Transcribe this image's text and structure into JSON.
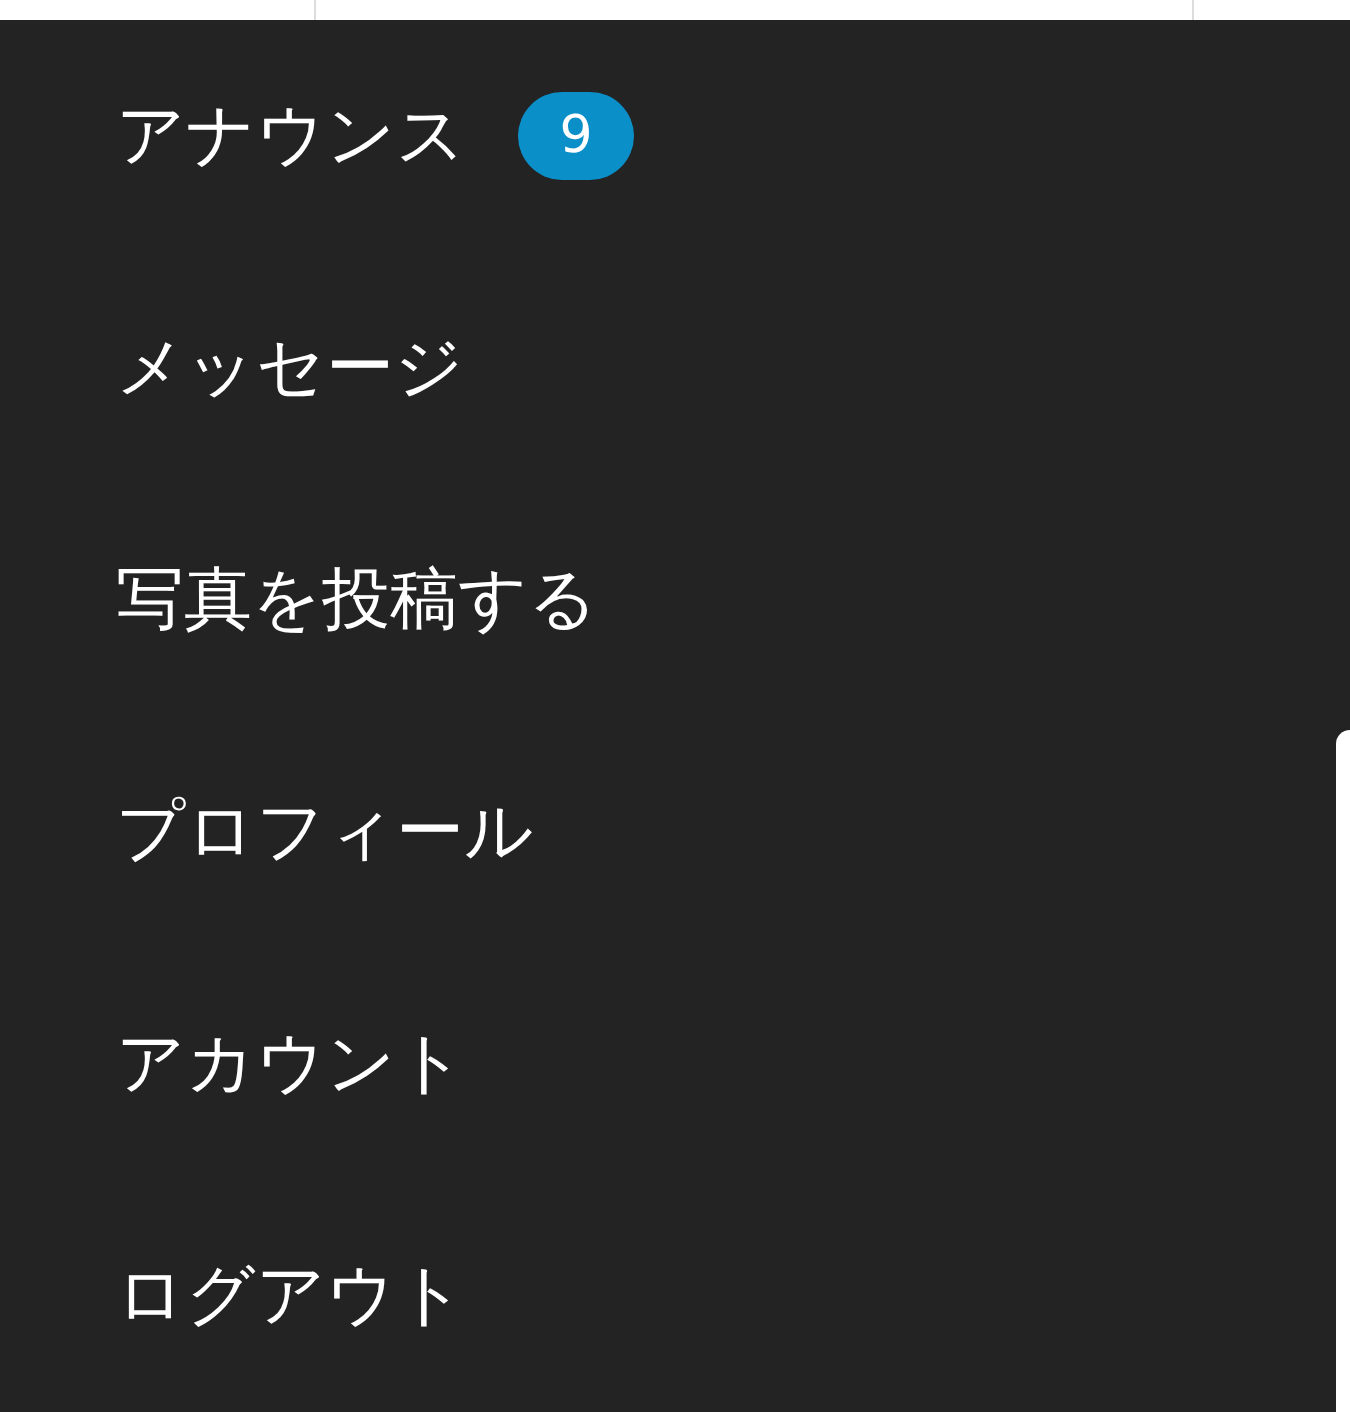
{
  "menu": {
    "items": [
      {
        "label": "アナウンス",
        "badge": "9"
      },
      {
        "label": "メッセージ"
      },
      {
        "label": "写真を投稿する"
      },
      {
        "label": "プロフィール"
      },
      {
        "label": "アカウント"
      },
      {
        "label": "ログアウト"
      }
    ]
  }
}
